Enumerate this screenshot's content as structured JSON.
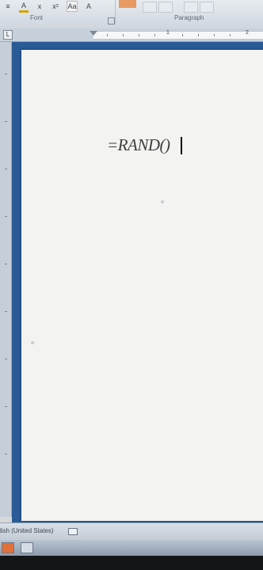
{
  "ribbon": {
    "tools": [
      {
        "icon": "align-icon",
        "glyph": "≡"
      },
      {
        "icon": "font-color-icon",
        "glyph": "A"
      },
      {
        "icon": "case-icon",
        "glyph": "x"
      },
      {
        "icon": "superscript-icon",
        "glyph": "x²"
      },
      {
        "icon": "change-case-icon",
        "glyph": "Aa"
      },
      {
        "icon": "highlight-icon",
        "glyph": "A"
      }
    ],
    "group_font_label": "Font",
    "group_paragraph_label": "Paragraph"
  },
  "ruler": {
    "tab_selector_glyph": "L",
    "numbers": [
      "1",
      "2"
    ]
  },
  "document": {
    "text": "=RAND()"
  },
  "statusbar": {
    "language": "lish (United States)"
  }
}
